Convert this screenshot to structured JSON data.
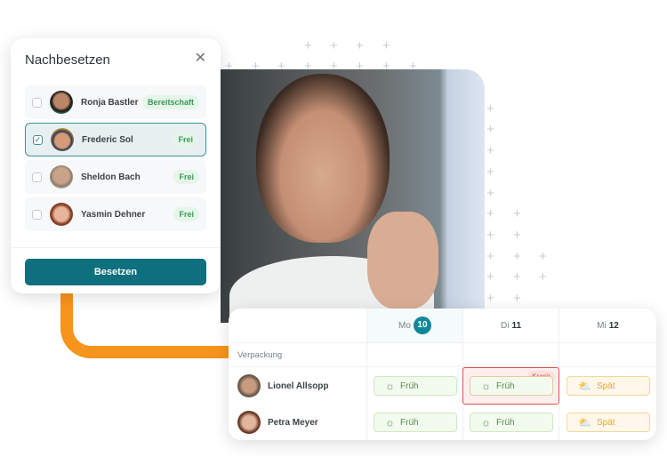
{
  "popup": {
    "title": "Nachbesetzen",
    "close_icon": "close-icon",
    "submit_label": "Besetzen",
    "candidates": [
      {
        "name": "Ronja Bastler",
        "status": "Bereitschaft",
        "checked": false
      },
      {
        "name": "Frederic Sol",
        "status": "Frei",
        "checked": true
      },
      {
        "name": "Sheldon Bach",
        "status": "Frei",
        "checked": false
      },
      {
        "name": "Yasmin Dehner",
        "status": "Frei",
        "checked": false
      }
    ]
  },
  "schedule": {
    "days": [
      {
        "label": "Mo",
        "num": "10",
        "today": true
      },
      {
        "label": "Di",
        "num": "11"
      },
      {
        "label": "Mi",
        "num": "12"
      }
    ],
    "group": "Verpackung",
    "employees": [
      {
        "name": "Lionel Allsopp",
        "shifts": [
          "Früh",
          "Früh",
          "Spät"
        ],
        "sick_badge": "Krank"
      },
      {
        "name": "Petra Meyer",
        "shifts": [
          "Früh",
          "Früh",
          "Spät"
        ]
      }
    ]
  },
  "colors": {
    "accent": "#0e6f7e",
    "today": "#108799",
    "orange": "#f7941d",
    "sick": "#d9534f"
  }
}
